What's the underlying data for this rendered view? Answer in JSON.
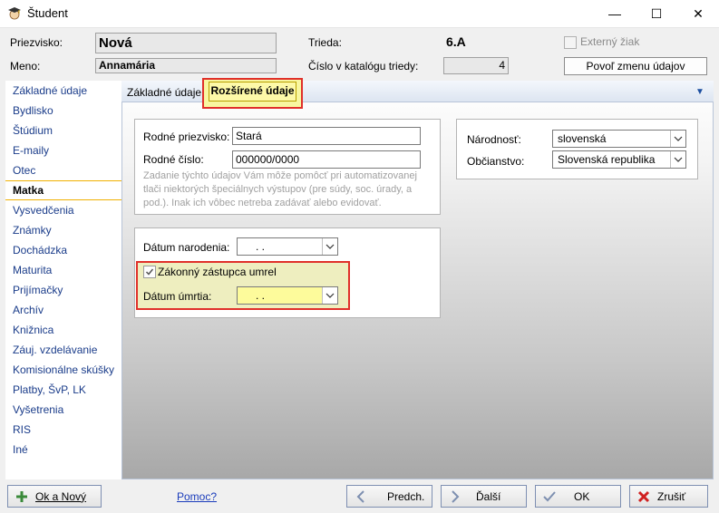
{
  "window": {
    "title": "Študent",
    "minimize_glyph": "—",
    "maximize_glyph": "☐",
    "close_glyph": "✕"
  },
  "header": {
    "surname_label": "Priezvisko:",
    "surname_value": "Nová",
    "name_label": "Meno:",
    "name_value": "Annamária",
    "class_label": "Trieda:",
    "class_value": "6.A",
    "catalog_label": "Číslo v katalógu triedy:",
    "catalog_value": "4",
    "external_label": "Externý žiak",
    "allow_change_button": "Povoľ zmenu údajov"
  },
  "sidebar": {
    "items": [
      {
        "label": "Základné údaje"
      },
      {
        "label": "Bydlisko"
      },
      {
        "label": "Štúdium"
      },
      {
        "label": "E-maily"
      },
      {
        "label": "Otec"
      },
      {
        "label": "Matka"
      },
      {
        "label": "Vysvedčenia"
      },
      {
        "label": "Známky"
      },
      {
        "label": "Dochádzka"
      },
      {
        "label": "Maturita"
      },
      {
        "label": "Prijímačky"
      },
      {
        "label": "Archív"
      },
      {
        "label": "Knižnica"
      },
      {
        "label": "Záuj. vzdelávanie"
      },
      {
        "label": "Komisionálne skúšky"
      },
      {
        "label": "Platby, ŠvP, LK"
      },
      {
        "label": "Vyšetrenia"
      },
      {
        "label": "RIS"
      },
      {
        "label": "Iné"
      }
    ],
    "active": "Matka"
  },
  "tabs": [
    {
      "label": "Základné údaje"
    },
    {
      "label": "Rozšírené údaje"
    }
  ],
  "form": {
    "birth_surname_label": "Rodné priezvisko:",
    "birth_surname_value": "Stará",
    "birth_number_label": "Rodné číslo:",
    "birth_number_value": "000000/0000",
    "hint": "Zadanie týchto údajov Vám môže pomôcť pri automatizovanej tlači niektorých špeciálnych výstupov (pre súdy, soc. úrady, a pod.). Inak ich vôbec netreba zadávať alebo evidovať.",
    "nationality_label": "Národnosť:",
    "nationality_value": "slovenská",
    "citizenship_label": "Občianstvo:",
    "citizenship_value": "Slovenská republika",
    "birth_date_label": "Dátum narodenia:",
    "birth_date_value": ".     .",
    "guardian_dead_label": "Zákonný zástupca umrel",
    "death_date_label": "Dátum úmrtia:",
    "death_date_value": ".     ."
  },
  "footer": {
    "ok_new": "Ok a Nový",
    "help": "Pomoc?",
    "prev": "Predch.",
    "next": "Ďalší",
    "ok": "OK",
    "cancel": "Zrušiť"
  },
  "colors": {
    "highlight_red": "#e0302a",
    "highlight_yellow": "#f8f7a0",
    "group_yellow": "#eeeebf"
  }
}
